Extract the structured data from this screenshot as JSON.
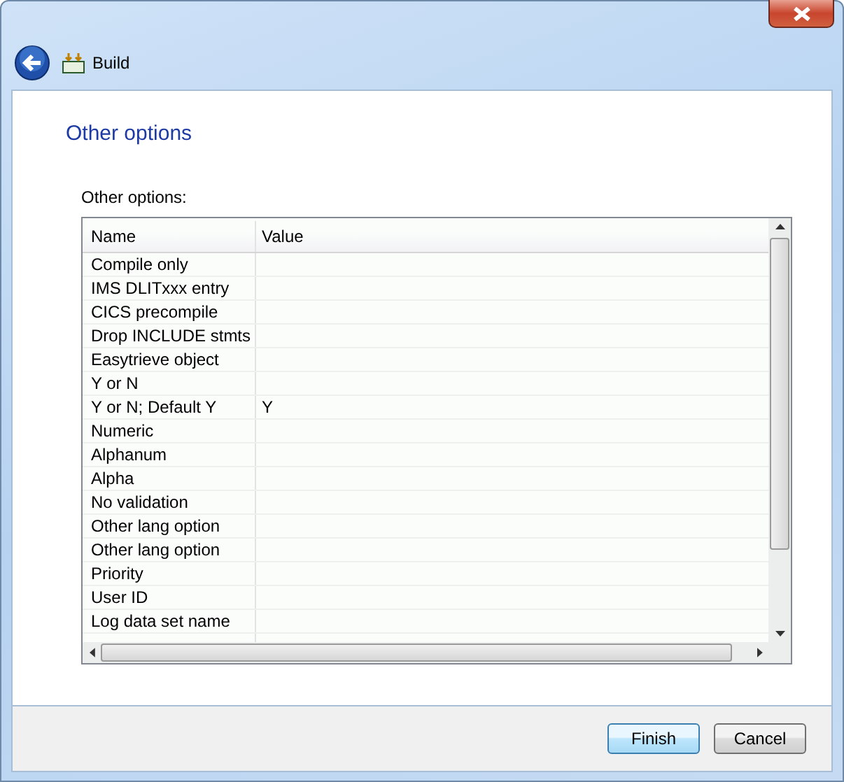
{
  "window": {
    "title": "Build"
  },
  "page": {
    "heading": "Other options",
    "list_label": "Other options:"
  },
  "table": {
    "columns": [
      "Name",
      "Value"
    ],
    "rows": [
      {
        "name": "Compile only",
        "value": ""
      },
      {
        "name": "IMS DLITxxx entry",
        "value": ""
      },
      {
        "name": "CICS precompile",
        "value": ""
      },
      {
        "name": "Drop INCLUDE stmts",
        "value": ""
      },
      {
        "name": "Easytrieve object",
        "value": ""
      },
      {
        "name": "Y or N",
        "value": ""
      },
      {
        "name": "Y or N; Default Y",
        "value": "Y"
      },
      {
        "name": "Numeric",
        "value": ""
      },
      {
        "name": "Alphanum",
        "value": ""
      },
      {
        "name": "Alpha",
        "value": ""
      },
      {
        "name": "No validation",
        "value": ""
      },
      {
        "name": "Other lang option",
        "value": ""
      },
      {
        "name": "Other lang option",
        "value": ""
      },
      {
        "name": "Priority",
        "value": ""
      },
      {
        "name": "User ID",
        "value": ""
      },
      {
        "name": "Log data set name",
        "value": ""
      }
    ]
  },
  "buttons": [
    {
      "label": "Finish",
      "default": true
    },
    {
      "label": "Cancel",
      "default": false
    }
  ]
}
